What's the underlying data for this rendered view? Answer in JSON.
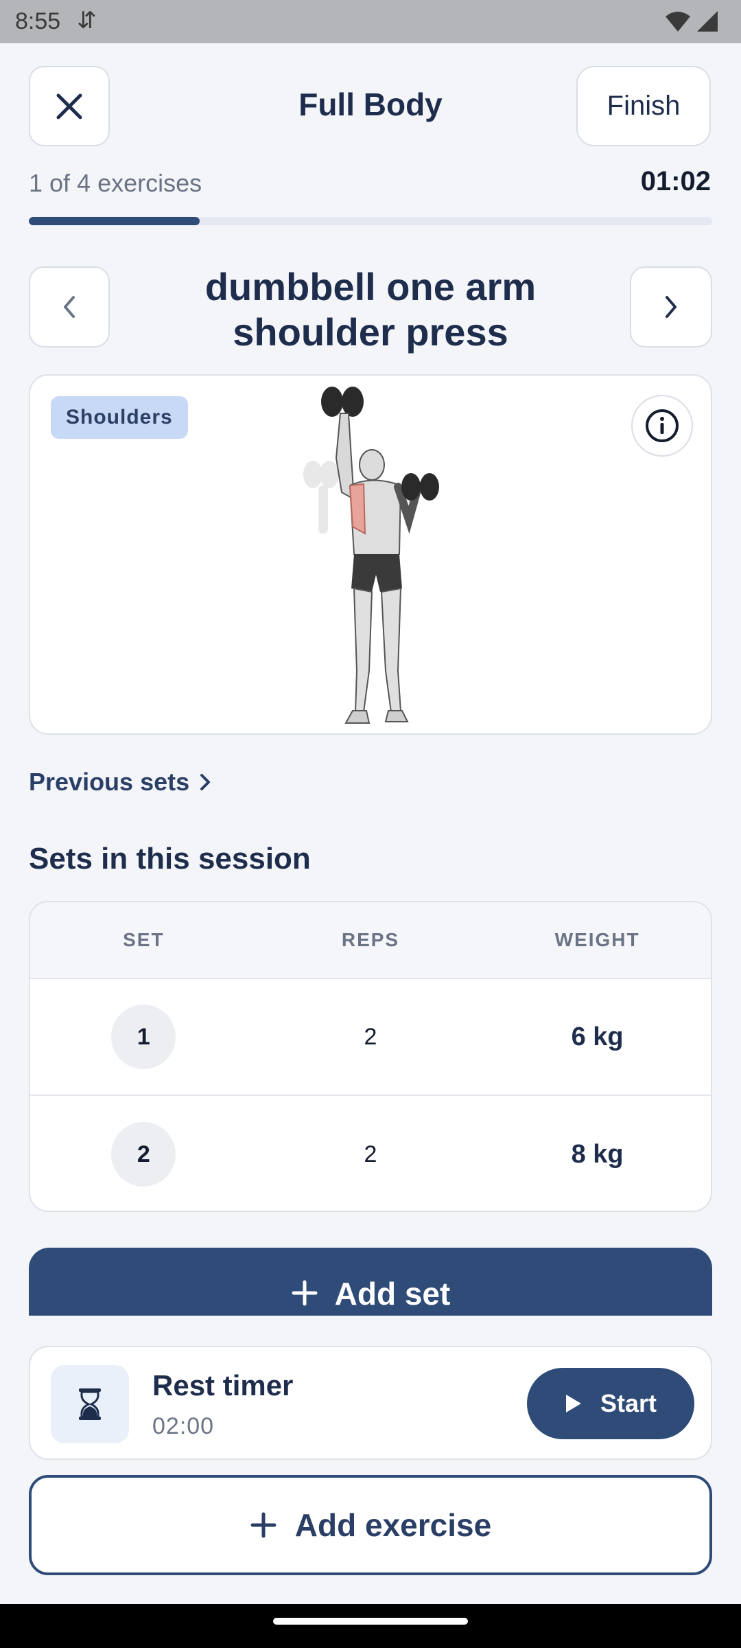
{
  "status_bar": {
    "time": "8:55",
    "sync_glyph": "⇵",
    "icons": [
      "wifi-icon",
      "signal-icon"
    ]
  },
  "header": {
    "title": "Full Body",
    "finish_label": "Finish",
    "close_icon": "close-icon"
  },
  "progress": {
    "label": "1 of 4 exercises",
    "timer": "01:02",
    "completed": 1,
    "total": 4
  },
  "exercise": {
    "title_line1": "dumbbell one arm",
    "title_line2": "shoulder press",
    "muscle": "Shoulders",
    "prev_icon": "chevron-left-icon",
    "next_icon": "chevron-right-icon",
    "info_icon": "info-icon"
  },
  "previous_sets": {
    "label": "Previous sets"
  },
  "sets_section": {
    "title": "Sets in this session",
    "columns": [
      "SET",
      "REPS",
      "WEIGHT"
    ],
    "rows": [
      {
        "set": "1",
        "reps": "2",
        "weight": "6 kg"
      },
      {
        "set": "2",
        "reps": "2",
        "weight": "8 kg"
      }
    ]
  },
  "add_set": {
    "label": "Add set"
  },
  "rest_timer": {
    "title": "Rest timer",
    "time": "02:00",
    "start_label": "Start"
  },
  "add_exercise": {
    "label": "Add exercise"
  },
  "colors": {
    "primary": "#2f4b78",
    "background": "#f3f5f9",
    "muscle_highlight": "#e8a49a",
    "badge": "#c7d9f5"
  }
}
